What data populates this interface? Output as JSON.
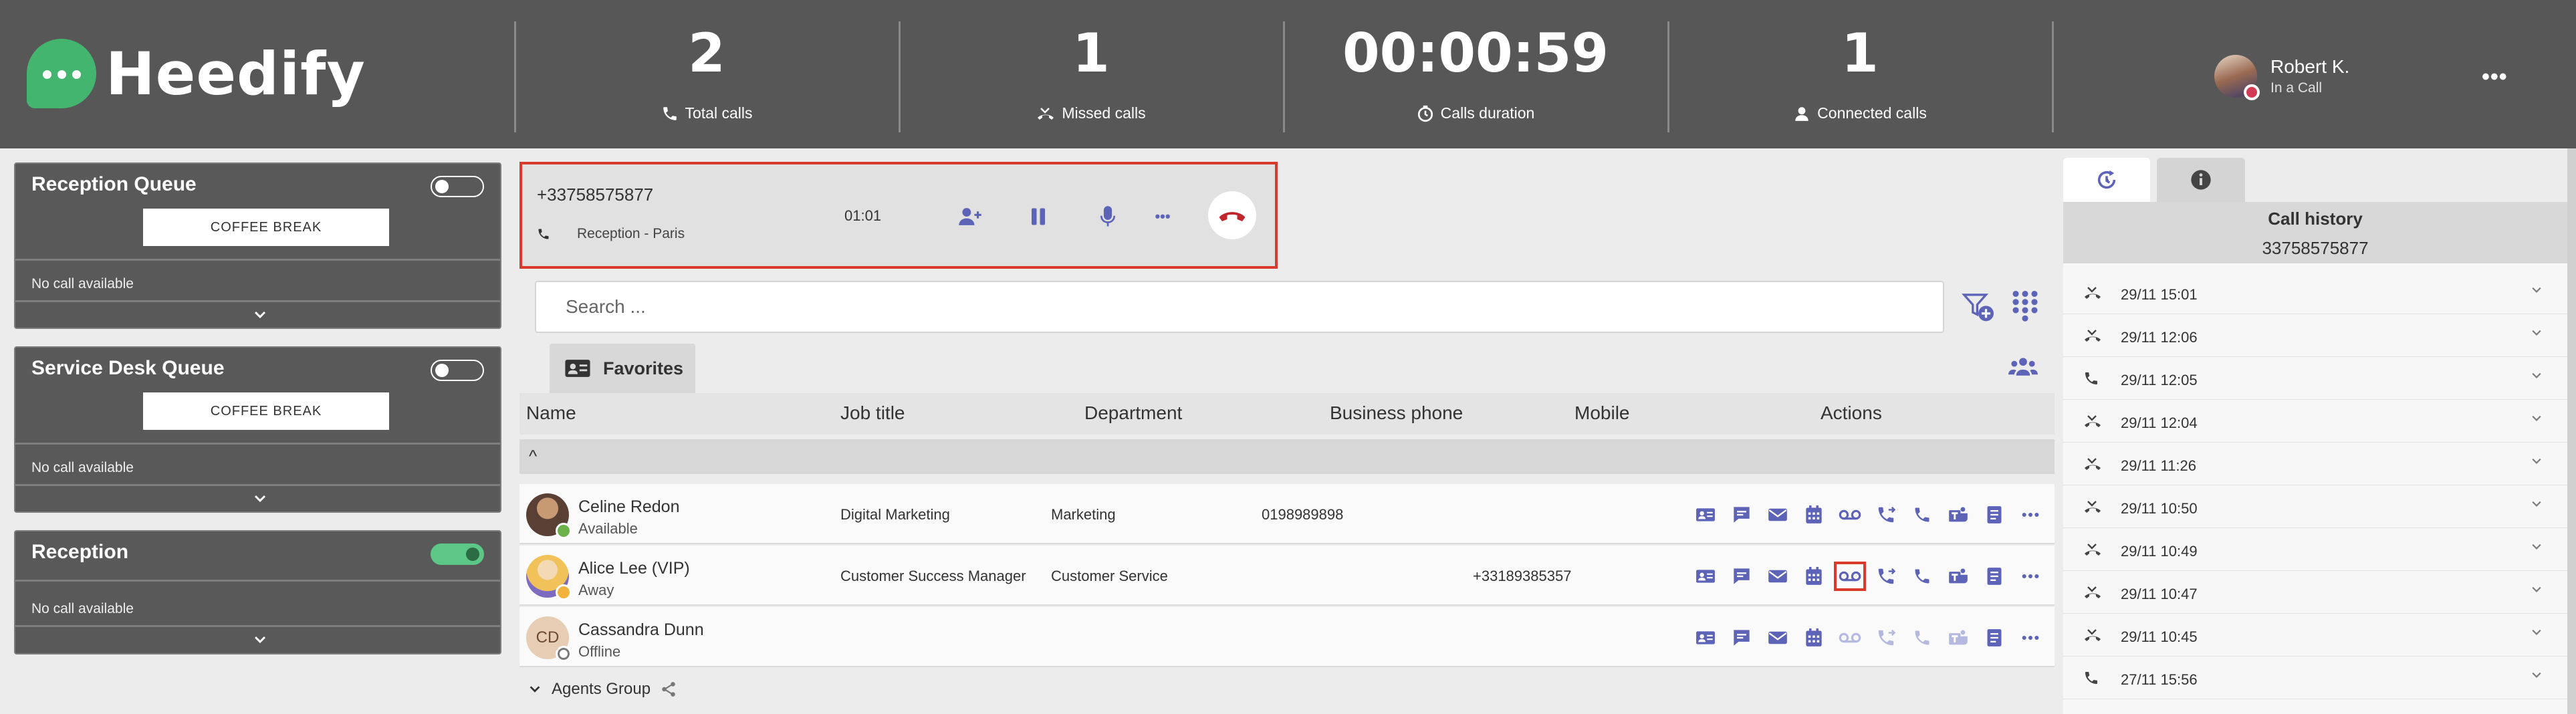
{
  "app": {
    "name": "Heedify"
  },
  "stats": [
    {
      "value": "2",
      "label": "Total calls",
      "icon": "phone-icon"
    },
    {
      "value": "1",
      "label": "Missed calls",
      "icon": "missed-call-icon"
    },
    {
      "value": "00:00:59",
      "label": "Calls duration",
      "icon": "timer-icon"
    },
    {
      "value": "1",
      "label": "Connected calls",
      "icon": "headset-icon"
    }
  ],
  "user": {
    "name": "Robert K.",
    "status": "In a Call",
    "menu": "•••"
  },
  "queues": [
    {
      "title": "Reception Queue",
      "toggle": "off",
      "button": "COFFEE BREAK",
      "status": "No call available"
    },
    {
      "title": "Service Desk Queue",
      "toggle": "off",
      "button": "COFFEE BREAK",
      "status": "No call available"
    },
    {
      "title": "Reception",
      "toggle": "on",
      "status": "No call available"
    }
  ],
  "active_call": {
    "number": "+33758575877",
    "queue": "Reception - Paris",
    "duration": "01:01",
    "more": "•••"
  },
  "search": {
    "placeholder": "Search ..."
  },
  "tabs": {
    "favorites": "Favorites"
  },
  "table": {
    "columns": [
      "Name",
      "Job title",
      "Department",
      "Business phone",
      "Mobile",
      "Actions"
    ],
    "group_toggle": "^",
    "rows": [
      {
        "name": "Celine Redon",
        "status": "Available",
        "job_title": "Digital Marketing",
        "department": "Marketing",
        "business_phone": "0198989898",
        "mobile": ""
      },
      {
        "name": "Alice Lee (VIP)",
        "status": "Away",
        "job_title": "Customer Success Manager",
        "department": "Customer Service",
        "business_phone": "",
        "mobile": "+33189385357"
      },
      {
        "name": "Cassandra Dunn",
        "initials": "CD",
        "status": "Offline",
        "job_title": "",
        "department": "",
        "business_phone": "",
        "mobile": ""
      }
    ],
    "agents_group": "Agents Group"
  },
  "history": {
    "title": "Call history",
    "number": "33758575877",
    "items": [
      {
        "time": "29/11 15:01",
        "type": "missed"
      },
      {
        "time": "29/11 12:06",
        "type": "missed"
      },
      {
        "time": "29/11 12:05",
        "type": "incoming"
      },
      {
        "time": "29/11 12:04",
        "type": "missed"
      },
      {
        "time": "29/11 11:26",
        "type": "missed"
      },
      {
        "time": "29/11 10:50",
        "type": "missed"
      },
      {
        "time": "29/11 10:49",
        "type": "missed"
      },
      {
        "time": "29/11 10:47",
        "type": "missed"
      },
      {
        "time": "29/11 10:45",
        "type": "missed"
      },
      {
        "time": "27/11 15:56",
        "type": "incoming"
      }
    ]
  },
  "colors": {
    "header": "#575757",
    "accent": "#5d64b8",
    "highlight": "#d93a2c",
    "logo_green": "#44b56f"
  }
}
